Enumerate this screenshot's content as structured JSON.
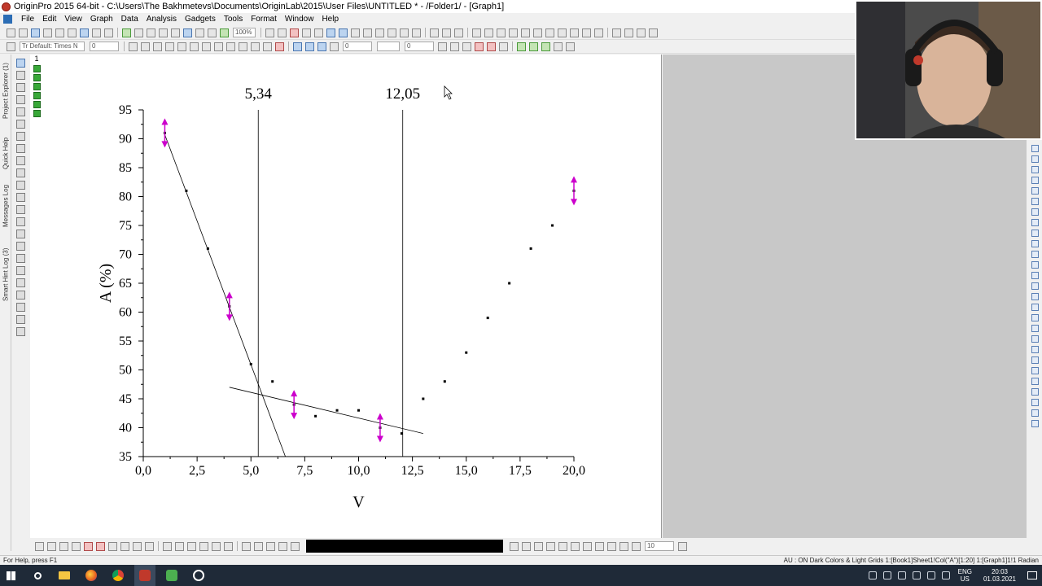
{
  "window": {
    "title": "OriginPro 2015 64-bit - C:\\Users\\The Bakhmetevs\\Documents\\OriginLab\\2015\\User Files\\UNTITLED * - /Folder1/ - [Graph1]"
  },
  "menu": [
    "File",
    "Edit",
    "View",
    "Graph",
    "Data",
    "Analysis",
    "Gadgets",
    "Tools",
    "Format",
    "Window",
    "Help"
  ],
  "toolbar": {
    "zoom_value": "100%",
    "font_name": "Tr Default: Times N",
    "font_size": "0",
    "line_width": "0",
    "fill_value": "0",
    "bottom_size": "10"
  },
  "side_tabs": [
    "Project Explorer (1)",
    "Quick Help",
    "Messages Log",
    "Smart Hint Log (3)"
  ],
  "layer": {
    "number": "1"
  },
  "chart_data": {
    "type": "scatter",
    "xlabel": "V",
    "ylabel": "A (%)",
    "xlim": [
      0,
      20
    ],
    "ylim": [
      35,
      95
    ],
    "x_ticks": [
      "0,0",
      "2,5",
      "5,0",
      "7,5",
      "10,0",
      "12,5",
      "15,0",
      "17,5",
      "20,0"
    ],
    "x_tick_values": [
      0,
      2.5,
      5,
      7.5,
      10,
      12.5,
      15,
      17.5,
      20
    ],
    "y_ticks": [
      "35",
      "40",
      "45",
      "50",
      "55",
      "60",
      "65",
      "70",
      "75",
      "80",
      "85",
      "90",
      "95"
    ],
    "y_tick_values": [
      35,
      40,
      45,
      50,
      55,
      60,
      65,
      70,
      75,
      80,
      85,
      90,
      95
    ],
    "series": [
      {
        "x": [
          1,
          2,
          3,
          4,
          5,
          6,
          7,
          8,
          9,
          10,
          11,
          12,
          13,
          14,
          15,
          16,
          17,
          18,
          19,
          20
        ],
        "y": [
          91,
          81,
          71,
          61,
          51,
          48,
          44,
          42,
          43,
          43,
          40,
          39,
          45,
          48,
          53,
          59,
          65,
          71,
          75,
          81
        ]
      }
    ],
    "error_bar_points": [
      {
        "x": 1,
        "y": 91
      },
      {
        "x": 4,
        "y": 61
      },
      {
        "x": 7,
        "y": 44
      },
      {
        "x": 11,
        "y": 40
      },
      {
        "x": 20,
        "y": 81
      }
    ],
    "fit_lines": [
      {
        "from": [
          1,
          90.7
        ],
        "to": [
          6.6,
          35
        ]
      },
      {
        "from": [
          4,
          47
        ],
        "to": [
          13,
          39
        ]
      }
    ],
    "vertical_lines": [
      {
        "x": 5.34,
        "label": "5,34"
      },
      {
        "x": 12.05,
        "label": "12,05"
      }
    ],
    "colors": {
      "points": "#000000",
      "error_bars": "#cc00cc"
    },
    "grid": false
  },
  "status": {
    "left": "For Help, press F1",
    "right": "AU : ON  Dark Colors & Light Grids  1:[Book1]Sheet1!Col(\"A\")[1:20]  1:[Graph1]1!1  Radian"
  },
  "taskbar": {
    "lang": "ENG",
    "region": "US",
    "time": "20:03",
    "date": "01.03.2021"
  }
}
